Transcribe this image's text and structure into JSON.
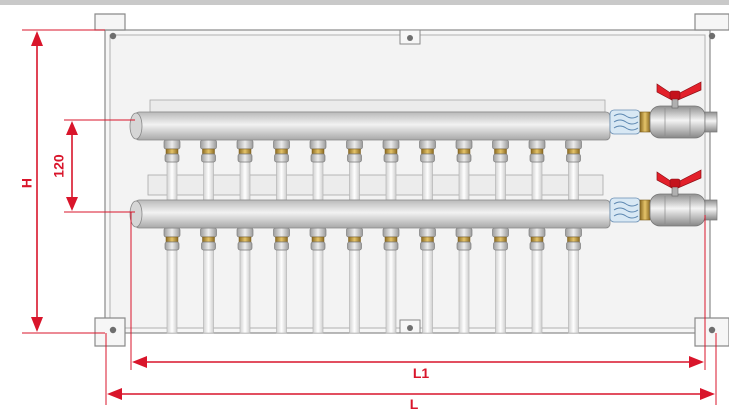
{
  "labels": {
    "height": "H",
    "spacing": "120",
    "inner_length": "L1",
    "total_length": "L"
  },
  "outlet_count": 12,
  "colors": {
    "dimension": "#d9152b",
    "cabinet": "#f2f2f2",
    "cabinet_edge": "#8a8a8a",
    "bar": "#e0e0e0",
    "pipe": "#f3f3f3",
    "brass": "#c59a3c",
    "valve_handle": "#e3202a",
    "top_band": "#c9c9c9"
  }
}
